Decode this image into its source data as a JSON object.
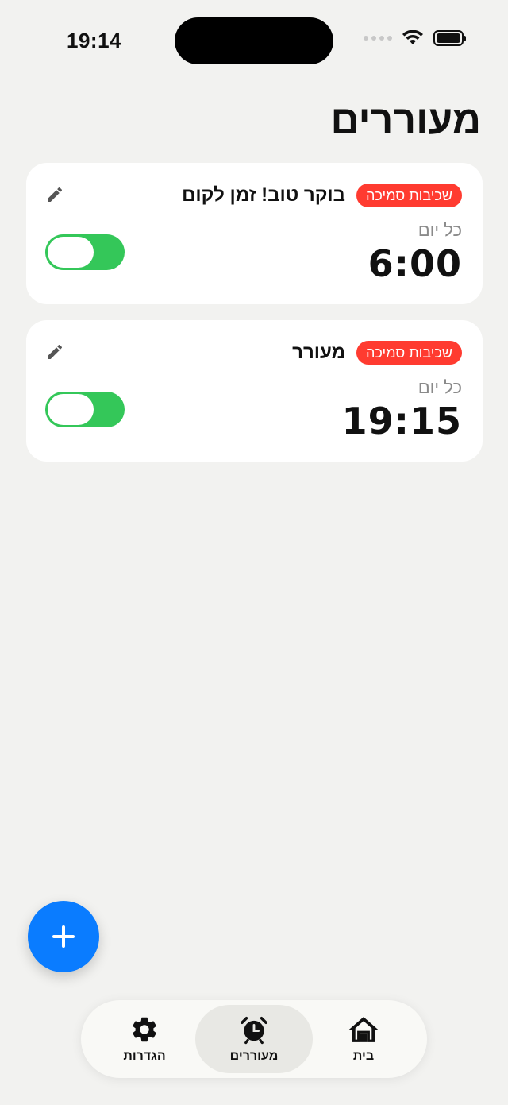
{
  "status_bar": {
    "time": "19:14"
  },
  "header": {
    "title": "מעוררים"
  },
  "alarms": [
    {
      "title": "בוקר טוב! זמן לקום",
      "badge": "שכיבות סמיכה",
      "repeat": "כל יום",
      "time": "6:00",
      "enabled": true
    },
    {
      "title": "מעורר",
      "badge": "שכיבות סמיכה",
      "repeat": "כל יום",
      "time": "19:15",
      "enabled": true
    }
  ],
  "tabs": [
    {
      "label": "הגדרות",
      "icon": "gear-icon"
    },
    {
      "label": "מעוררים",
      "icon": "alarm-clock-icon",
      "active": true
    },
    {
      "label": "בית",
      "icon": "home-icon"
    }
  ],
  "colors": {
    "accent": "#0a7cff",
    "toggle_on": "#34c759",
    "badge": "#ff3b30"
  }
}
